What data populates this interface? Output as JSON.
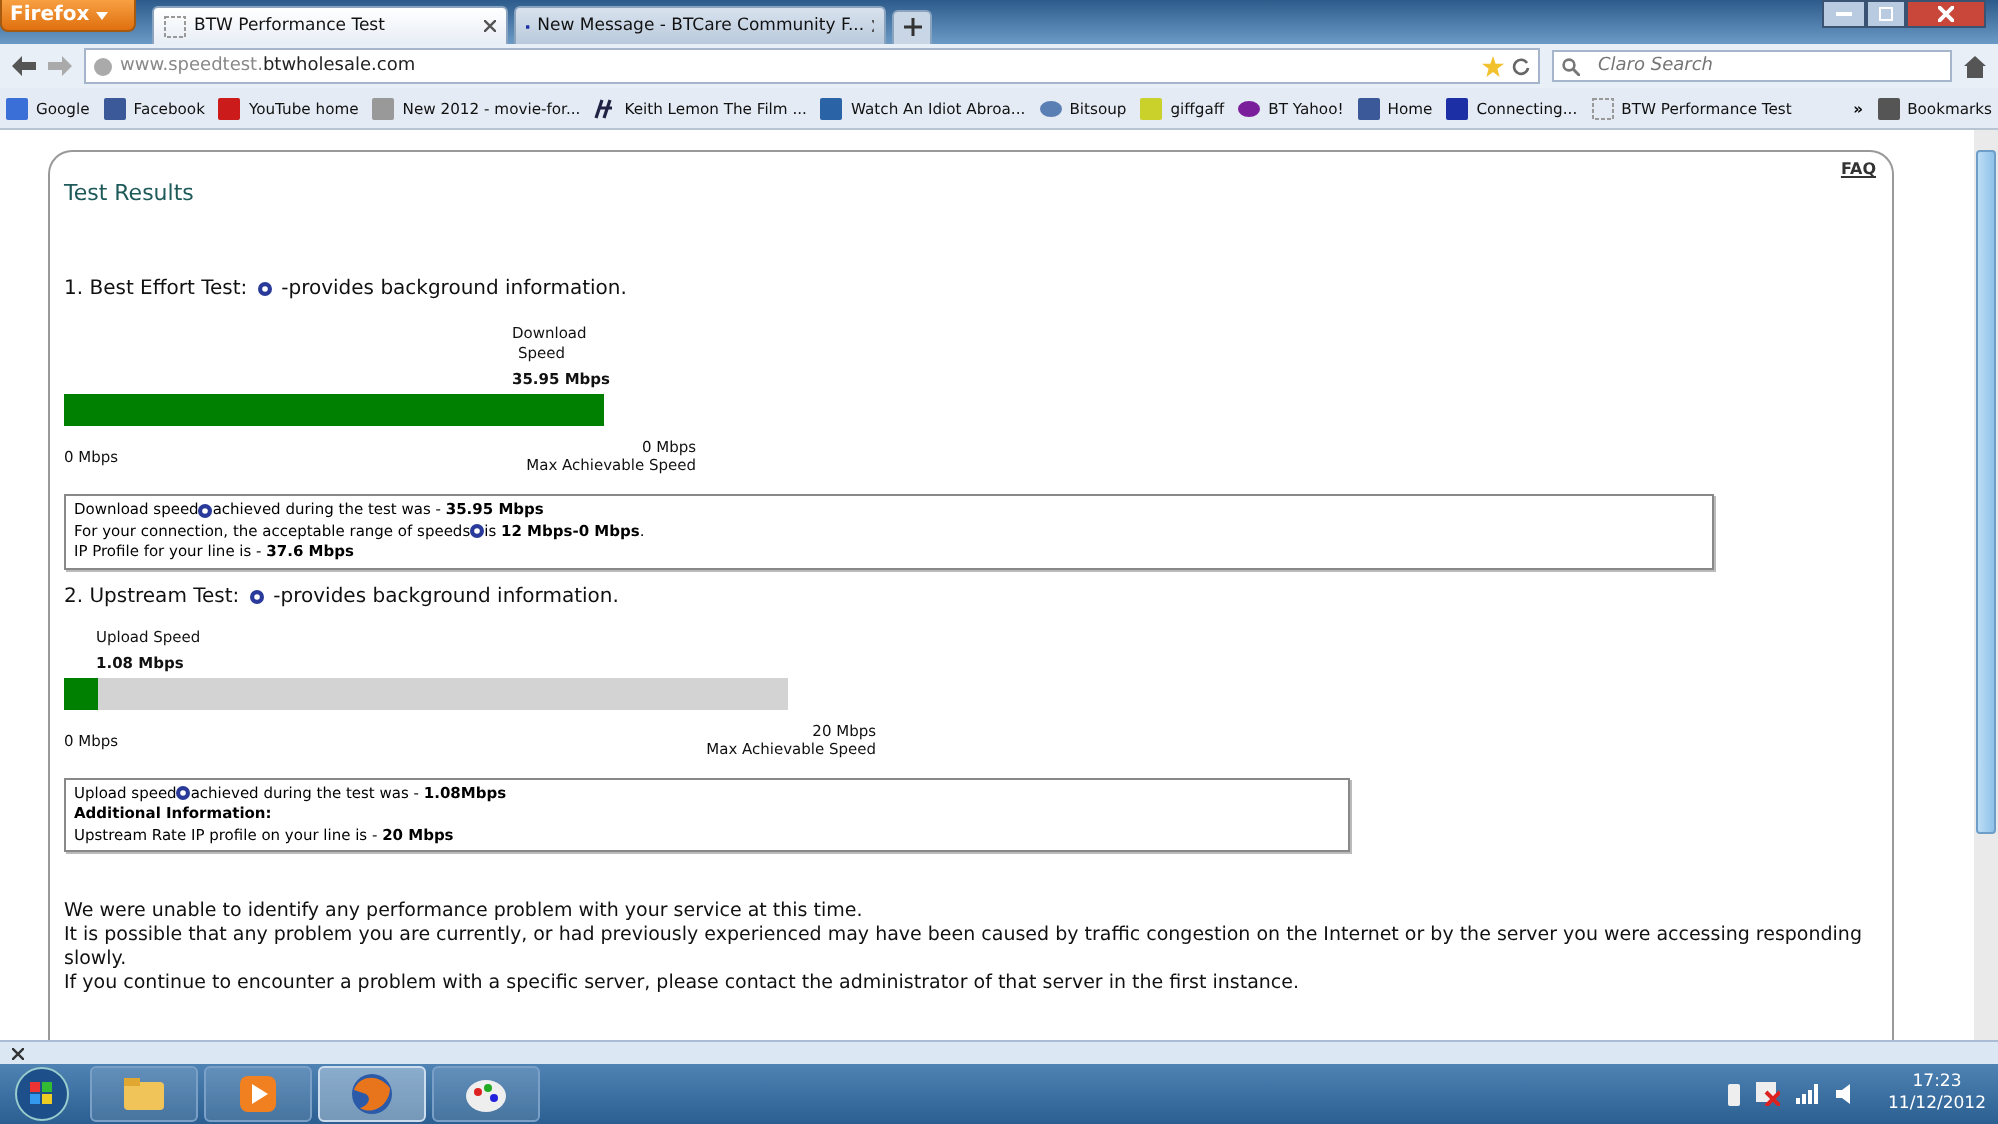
{
  "browser": {
    "menu_button": "Firefox",
    "tabs": [
      {
        "title": "BTW Performance Test",
        "selected": true
      },
      {
        "title": "New Message - BTCare Community F...",
        "selected": false
      }
    ],
    "url": {
      "host": "www.speedtest.",
      "domain": "btwholesale.com"
    },
    "search_placeholder": "Claro Search",
    "bookmarks": [
      {
        "label": "Google"
      },
      {
        "label": "Facebook"
      },
      {
        "label": "YouTube home"
      },
      {
        "label": "New 2012 - movie-for..."
      },
      {
        "label": "Keith Lemon The Film ..."
      },
      {
        "label": "Watch An Idiot Abroa..."
      },
      {
        "label": "Bitsoup"
      },
      {
        "label": "giffgaff"
      },
      {
        "label": "BT Yahoo!"
      },
      {
        "label": "Home"
      },
      {
        "label": "Connecting..."
      },
      {
        "label": "BTW Performance Test"
      }
    ],
    "bookmarks_more": "»",
    "bookmarks_menu": "Bookmarks"
  },
  "page": {
    "faq": "FAQ",
    "title": "Test Results",
    "tests": [
      {
        "heading": "1. Best Effort Test:",
        "note": "-provides background information.",
        "speed_label": [
          "Download",
          "Speed"
        ],
        "speed_value": "35.95 Mbps",
        "level": 1.0,
        "min": "0 Mbps",
        "max": "0 Mbps",
        "max_caption": "Max Achievable Speed",
        "info": [
          {
            "text": "Download speed",
            "after": "achieved during the test was - **35.95 Mbps**"
          },
          {
            "text": "For your connection, the acceptable range of speeds",
            "after": " is **12 Mbps-0 Mbps**."
          },
          {
            "text": "IP Profile for your line is - **37.6 Mbps**"
          }
        ]
      },
      {
        "heading": "2. Upstream Test:",
        "note": "-provides background information.",
        "speed_label": [
          "Upload Speed"
        ],
        "speed_value": "1.08 Mbps",
        "level": 0.047,
        "min": "0 Mbps",
        "max": "20 Mbps",
        "max_caption": "Max Achievable Speed",
        "info": [
          {
            "text": "Upload speed",
            "after": " achieved during the test was - **1.08Mbps**"
          },
          {
            "text": "**Additional Information:**"
          },
          {
            "text": "Upstream Rate IP profile on your line is - **20 Mbps**"
          }
        ]
      }
    ],
    "messages": [
      "We were unable to identify any performance problem with your service at this time.",
      "It is possible that any problem you are currently, or had previously experienced may have been caused by traffic congestion on the Internet or by the server you were accessing responding slowly.",
      "If you continue to encounter a problem with a specific server, please contact the administrator of that server in the first instance."
    ]
  },
  "taskbar": {
    "apps": [
      {
        "kind": "folder",
        "selected": false
      },
      {
        "kind": "media",
        "selected": false
      },
      {
        "kind": "firefox",
        "selected": true
      },
      {
        "kind": "paint",
        "selected": false
      }
    ],
    "time": "17:23",
    "date": "11/12/2012"
  }
}
